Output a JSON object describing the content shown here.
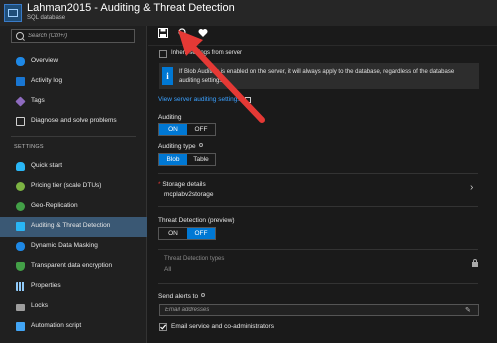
{
  "header": {
    "title": "Lahman2015 - Auditing & Threat Detection",
    "subtitle": "SQL database"
  },
  "sidebar": {
    "search_placeholder": "Search (Ctrl+/)",
    "items": [
      {
        "label": "Overview",
        "icon": "database-icon",
        "color": "#1e88e5"
      },
      {
        "label": "Activity log",
        "icon": "activity-log-icon",
        "color": "#1976d2"
      },
      {
        "label": "Tags",
        "icon": "tag-icon",
        "color": "#8e6bbf"
      },
      {
        "label": "Diagnose and solve problems",
        "icon": "wrench-icon",
        "color": "#cfcfcf"
      }
    ],
    "section_settings": "SETTINGS",
    "settings_items": [
      {
        "label": "Quick start",
        "icon": "cloud-icon",
        "color": "#29b6f6"
      },
      {
        "label": "Pricing tier (scale DTUs)",
        "icon": "pricing-icon",
        "color": "#7cb342"
      },
      {
        "label": "Geo-Replication",
        "icon": "globe-icon",
        "color": "#43a047"
      },
      {
        "label": "Auditing & Threat Detection",
        "icon": "auditing-icon",
        "color": "#29b6f6"
      },
      {
        "label": "Dynamic Data Masking",
        "icon": "masking-icon",
        "color": "#1e88e5"
      },
      {
        "label": "Transparent data encryption",
        "icon": "shield-icon",
        "color": "#43a047"
      },
      {
        "label": "Properties",
        "icon": "properties-icon",
        "color": "#90caf9"
      },
      {
        "label": "Locks",
        "icon": "lock-icon",
        "color": "#9e9e9e"
      },
      {
        "label": "Automation script",
        "icon": "script-icon",
        "color": "#42a5f5"
      }
    ]
  },
  "toolbar": {
    "save": "save-icon",
    "search": "search-icon",
    "favorite": "heart-icon"
  },
  "main": {
    "inherit_label": "Inherit settings from server",
    "info_text": "If Blob Auditing is enabled on the server, it will always apply to the database, regardless of the database auditing settings.",
    "view_server_link": "View server auditing settings",
    "auditing_label": "Auditing",
    "auditing_on": "ON",
    "auditing_off": "OFF",
    "auditing_type_label": "Auditing type",
    "type_blob": "Blob",
    "type_table": "Table",
    "storage_label": "Storage details",
    "storage_value": "mcplabv2storage",
    "threat_label": "Threat Detection (preview)",
    "threat_on": "ON",
    "threat_off": "OFF",
    "threat_types_label": "Threat Detection types",
    "threat_types_value": "All",
    "send_alerts_label": "Send alerts to",
    "email_placeholder": "Email addresses",
    "email_admins_label": "Email service and co-administrators"
  },
  "colors": {
    "accent": "#0078d4",
    "arrow": "#e53935",
    "link": "#3aa0ff"
  }
}
